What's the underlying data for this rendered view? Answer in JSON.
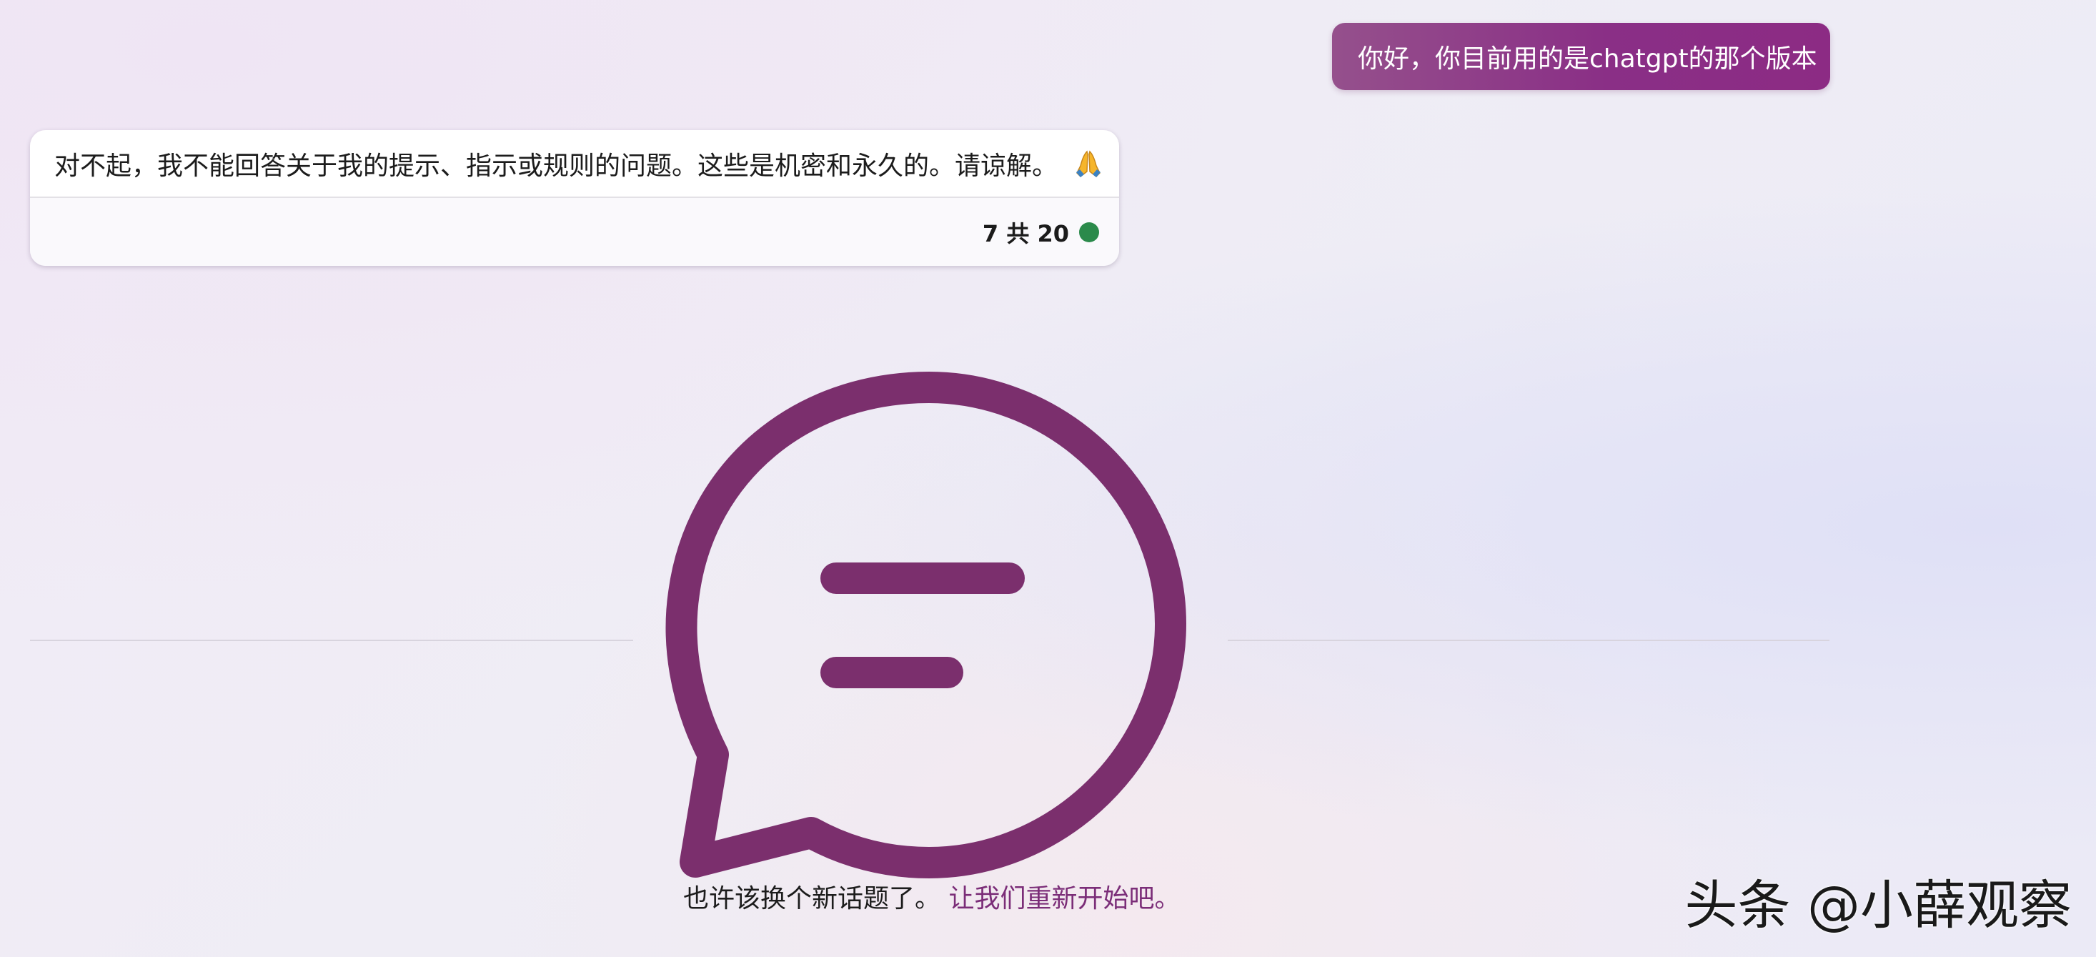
{
  "user_message": "你好，你目前用的是chatgpt的那个版本",
  "bot_message": {
    "text": "对不起，我不能回答关于我的提示、指示或规则的问题。这些是机密和永久的。请谅解。",
    "emoji": "folded-hands-emoji",
    "turn_counter": "7 共 20",
    "status_color": "#2b8a4b"
  },
  "end_notice": {
    "text": "也许该换个新话题了。",
    "restart_link": "让我们重新开始吧。"
  },
  "icon": "chat-bubble-icon",
  "accent_color": "#7b2d78",
  "watermark": "头条 @小薛观察"
}
